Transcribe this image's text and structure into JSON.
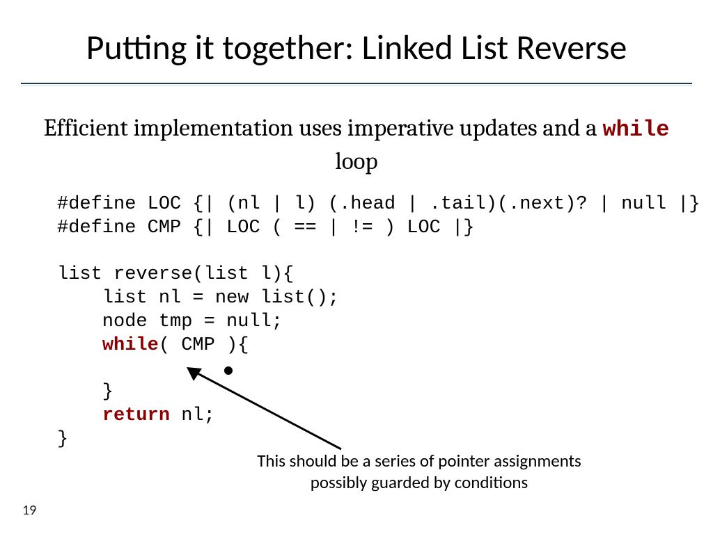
{
  "slide": {
    "title": "Putting it together: Linked List Reverse",
    "subtitle_pre": "Efficient implementation uses imperative updates and a ",
    "subtitle_kw": "while",
    "subtitle_post": " loop",
    "page_number": "19"
  },
  "code": {
    "l1": "#define LOC {| (nl | l) (.head | .tail)(.next)? | null |}",
    "l2": "#define CMP {| LOC ( == | != ) LOC |}",
    "l3": "",
    "l4": "list reverse(list l){",
    "l5": "    list nl = new list();",
    "l6": "    node tmp = null;",
    "l7a": "    ",
    "l7kw": "while",
    "l7b": "( CMP ){",
    "l8": " ",
    "l9": "    }",
    "l10a": "    ",
    "l10kw": "return",
    "l10b": " nl;",
    "l11": "}"
  },
  "annotation": {
    "line1": "This should be a series of pointer assignments",
    "line2": "possibly guarded by conditions"
  }
}
